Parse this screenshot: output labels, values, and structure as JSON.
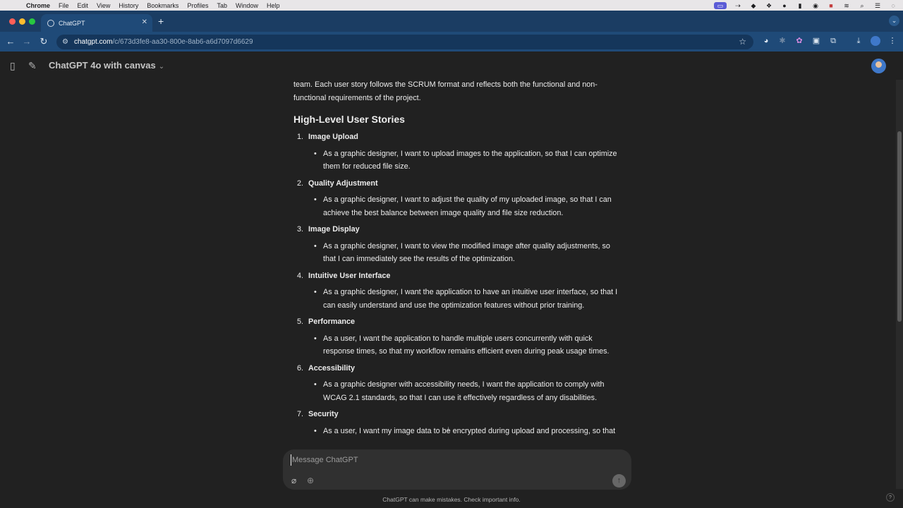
{
  "menubar": {
    "app": "Chrome",
    "items": [
      "File",
      "Edit",
      "View",
      "History",
      "Bookmarks",
      "Profiles",
      "Tab",
      "Window",
      "Help"
    ]
  },
  "browser": {
    "tab_title": "ChatGPT",
    "url_host": "chatgpt.com",
    "url_path": "/c/673d3fe8-aa30-800e-8ab6-a6d7097d6629"
  },
  "header": {
    "model": "ChatGPT 4o with canvas"
  },
  "content": {
    "intro": "team. Each user story follows the SCRUM format and reflects both the functional and non-functional requirements of the project.",
    "heading": "High-Level User Stories",
    "stories": [
      {
        "num": "1.",
        "title": "Image Upload",
        "text": "As a graphic designer, I want to upload images to the application, so that I can optimize them for reduced file size."
      },
      {
        "num": "2.",
        "title": "Quality Adjustment",
        "text": "As a graphic designer, I want to adjust the quality of my uploaded image, so that I can achieve the best balance between image quality and file size reduction."
      },
      {
        "num": "3.",
        "title": "Image Display",
        "text": "As a graphic designer, I want to view the modified image after quality adjustments, so that I can immediately see the results of the optimization."
      },
      {
        "num": "4.",
        "title": "Intuitive User Interface",
        "text": "As a graphic designer, I want the application to have an intuitive user interface, so that I can easily understand and use the optimization features without prior training."
      },
      {
        "num": "5.",
        "title": "Performance",
        "text": "As a user, I want the application to handle multiple users concurrently with quick response times, so that my workflow remains efficient even during peak usage times."
      },
      {
        "num": "6.",
        "title": "Accessibility",
        "text": "As a graphic designer with accessibility needs, I want the application to comply with WCAG 2.1 standards, so that I can use it effectively regardless of any disabilities."
      },
      {
        "num": "7.",
        "title": "Security",
        "text": "As a user, I want my image data to be encrypted during upload and processing, so that"
      }
    ]
  },
  "composer": {
    "placeholder": "Message ChatGPT"
  },
  "footer": {
    "disclaimer": "ChatGPT can make mistakes. Check important info.",
    "help": "?"
  },
  "icons": {
    "apple": "apple-icon",
    "sidebar": "sidebar-toggle-icon",
    "new_chat": "new-chat-icon",
    "attach": "paperclip-icon",
    "globe": "globe-icon",
    "send": "send-arrow-icon"
  },
  "colors": {
    "background": "#212121",
    "tabstrip": "#1b3d63",
    "toolbar": "#1f4a78",
    "composer": "#303030"
  }
}
